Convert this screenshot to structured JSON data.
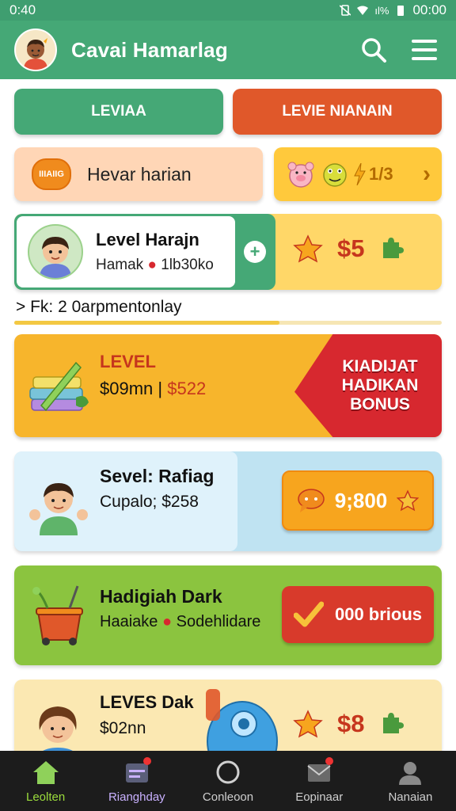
{
  "status_bar": {
    "time": "0:40",
    "right_time": "00:00",
    "signal_text": "ıl%"
  },
  "app_bar": {
    "title": "Cavai Hamarlag"
  },
  "tabs": [
    {
      "label": "LEVIAA",
      "color": "#45a876"
    },
    {
      "label": "LEVIE NIANAIN",
      "color": "#e0582a"
    }
  ],
  "row2": {
    "badge_text": "IIIAIIG",
    "text": "Hevar harian",
    "emoji_count_text": "1/3",
    "chevron": "›"
  },
  "level_card": {
    "title": "Level Harajn",
    "subtitle_prefix": "Hamak",
    "subtitle_value": "1lb30ko",
    "plus": "+",
    "price": "$5"
  },
  "progress": {
    "text": "Fk: 2 0arpmentonlay",
    "prefix": ">",
    "fraction": 0.62
  },
  "bonus_card": {
    "label": "LEVEL",
    "amount_main": "$09mn",
    "amount_sep": " | ",
    "amount_red": "$522",
    "ribbon_text": "KIADIJAT HADIKAN BONUS"
  },
  "blue_card": {
    "title": "Sevel: Rafiag",
    "subtitle": "Cupalo; $258",
    "button_value": "9;800"
  },
  "green_card": {
    "title": "Hadigiah Dark",
    "subtitle_prefix": "Haaiake",
    "subtitle_suffix": "Sodehlidare",
    "button_label": "000 brious"
  },
  "yellow_card": {
    "title": "LEVES Dak",
    "subtitle": "$02nn",
    "price": "$8"
  },
  "bottom_nav": [
    {
      "label": "Leolten",
      "icon": "home-icon"
    },
    {
      "label": "Rianghday",
      "icon": "calendar-icon"
    },
    {
      "label": "Conleoon",
      "icon": "circle-icon"
    },
    {
      "label": "Eopinaar",
      "icon": "mail-icon"
    },
    {
      "label": "Nanaian",
      "icon": "profile-icon"
    }
  ],
  "colors": {
    "primary_green": "#45a876",
    "accent_orange": "#e0582a",
    "price_red": "#c6361d",
    "nav_active": "#9bdc3c"
  }
}
